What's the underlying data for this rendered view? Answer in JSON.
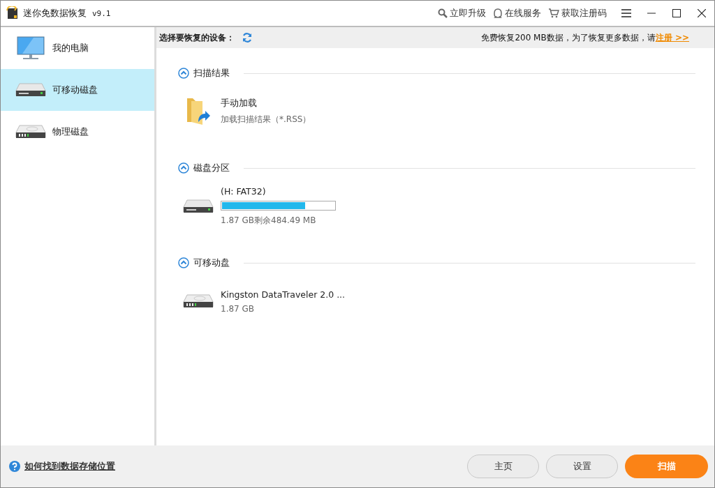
{
  "window": {
    "title": "迷你免数据恢复",
    "version": "v9.1"
  },
  "toolbar": [
    {
      "kind": "upgrade",
      "label": "立即升级"
    },
    {
      "kind": "service",
      "label": "在线服务"
    },
    {
      "kind": "cart",
      "label": "获取注册码"
    }
  ],
  "sidebar": {
    "items": [
      {
        "kind": "monitor",
        "label": "我的电脑",
        "selected": false
      },
      {
        "kind": "removable",
        "label": "可移动磁盘",
        "selected": true
      },
      {
        "kind": "physical",
        "label": "物理磁盘",
        "selected": false
      }
    ]
  },
  "header": {
    "label": "选择要恢复的设备：",
    "notice": "免费恢复200 MB数据，为了恢复更多数据，请",
    "link": "注册 >>"
  },
  "sections": [
    {
      "title": "扫描结果",
      "expanded": true,
      "items": [
        {
          "kind": "folder",
          "name": "手动加载",
          "detail": "加载扫描结果（*.RSS）"
        }
      ]
    },
    {
      "title": "磁盘分区",
      "expanded": true,
      "items": [
        {
          "kind": "partition",
          "name": "(H: FAT32)",
          "level": 0.74,
          "detail": "1.87 GB剩余484.49 MB"
        }
      ]
    },
    {
      "title": "可移动盘",
      "expanded": true,
      "items": [
        {
          "kind": "physical",
          "name": "Kingston DataTraveler 2.0 ...",
          "detail": "1.87 GB"
        }
      ]
    }
  ],
  "footer": {
    "help_link": "如何找到数据存储位置",
    "buttons": [
      {
        "kind": "secondary",
        "label": "主页"
      },
      {
        "kind": "secondary",
        "label": "设置"
      },
      {
        "kind": "primary",
        "label": "扫描"
      }
    ]
  }
}
